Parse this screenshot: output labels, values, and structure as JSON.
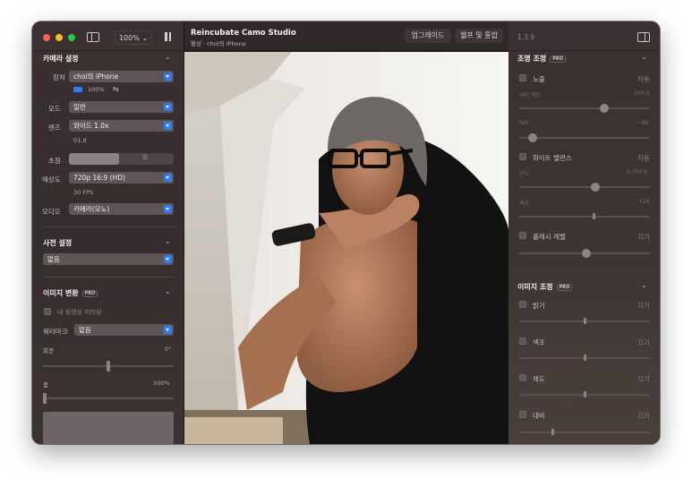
{
  "titlebar": {
    "zoom": "100%",
    "app_title": "Reincubate Camo Studio",
    "subtitle": "활성 · choi의 iPhone",
    "upgrade": "업그레이드",
    "help": "헬프 및 통합",
    "version": "1.3.9"
  },
  "camera": {
    "title": "카메라 설정",
    "device_label": "장치",
    "device": "choi의 iPhone",
    "battery": "100%",
    "mode_label": "모드",
    "mode": "일반",
    "lens_label": "렌즈",
    "lens": "와이드 1.0x",
    "aperture": "f/1.8",
    "focus_label": "초점",
    "resolution_label": "해상도",
    "resolution": "720p 16:9 (HD)",
    "fps": "30 FPS",
    "audio_label": "오디오",
    "audio": "카메라(모노)"
  },
  "presets": {
    "title": "사전 설정",
    "value": "없음"
  },
  "transform": {
    "title": "이미지 변환",
    "pro": "PRO",
    "mirror": "내 동영상 미러링",
    "watermark_label": "워터마크",
    "watermark": "없음",
    "rotation_label": "회전",
    "rotation_value": "0°",
    "rotation_pct": 0.5,
    "zoom_label": "줌",
    "zoom_value": "100%"
  },
  "lighting": {
    "title": "조명 조정",
    "pro": "PRO",
    "exposure": "노출",
    "exposure_auto": "자동",
    "shutter": "셔터 속도",
    "shutter_value": "100.0",
    "iso": "ISO",
    "iso_value": "~85",
    "white_balance": "화이트 밸런스",
    "wb_auto": "자동",
    "temp": "온도",
    "temp_value": "5,700 K",
    "tint": "색조",
    "tint_value": "+29",
    "flash": "플래시 레벨",
    "flash_state": "끄기"
  },
  "image_adjust": {
    "title": "이미지 조정",
    "pro": "PRO",
    "items": [
      {
        "label": "밝기",
        "state": "끄기"
      },
      {
        "label": "색조",
        "state": "끄기"
      },
      {
        "label": "채도",
        "state": "끄기"
      },
      {
        "label": "대비",
        "state": "끄기"
      }
    ]
  },
  "colors": {
    "accent": "#2f7cf6",
    "close": "#ff5f57",
    "minimize": "#febc2e",
    "zoom": "#28c840"
  }
}
